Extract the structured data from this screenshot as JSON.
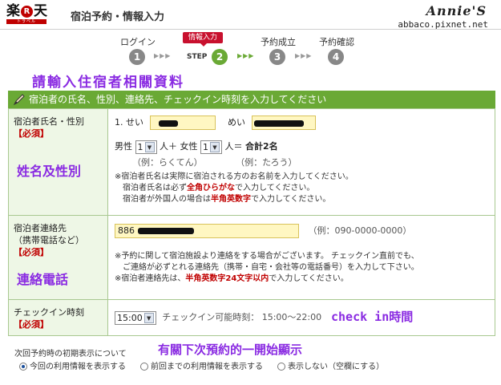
{
  "header": {
    "logo_text_left": "楽",
    "logo_text_r": "R",
    "logo_text_right": "天",
    "logo_subtext": "トラベル",
    "title": "宿泊予約・情報入力",
    "watermark_name": "Annie'S",
    "watermark_url": "abbaco.pixnet.net"
  },
  "steps": [
    {
      "label": "ログイン",
      "number": "1"
    },
    {
      "label": "情報入力",
      "number": "2",
      "step_word": "STEP",
      "active": true
    },
    {
      "label": "予約成立",
      "number": "3"
    },
    {
      "label": "予約確認",
      "number": "4"
    }
  ],
  "step_arrows": "▶▶▶",
  "annotations": {
    "top": "請輸入住宿者相關資料",
    "name_gender": "姓名及性別",
    "phone": "連絡電話",
    "checkin": "check in時間",
    "display": "有關下次預約的一開始顯示"
  },
  "banner": "宿泊者の氏名、性別、連絡先、チェックイン時刻を入力してください",
  "guest_name": {
    "label": "宿泊者氏名・性別",
    "required": "【必須】",
    "sei_label": "1. せい",
    "mei_label": "めい",
    "male_label": "男性",
    "male_value": "1",
    "person_plus": "人＋",
    "female_label": "女性",
    "female_value": "1",
    "person_eq": "人＝",
    "total": "合計2名",
    "example1": "（例：らくてん）",
    "example2": "（例：たろう）",
    "note1": "※宿泊者氏名は実際に宿泊される方のお名前を入力してください。",
    "note2_a": "宿泊者氏名は必ず",
    "note2_red": "全角ひらがな",
    "note2_b": "で入力してください。",
    "note3_a": "宿泊者が外国人の場合は",
    "note3_red": "半角英数字",
    "note3_b": "で入力してください。"
  },
  "contact": {
    "label": "宿泊者連絡先",
    "label2": "（携帯電話など）",
    "required": "【必須】",
    "phone_value": "886",
    "example": "（例：090-0000-0000）",
    "note1": "※予約に関して宿泊施設より連絡をする場合がございます。 チェックイン直前でも、",
    "note2": "ご連絡が必ずとれる連絡先（携帯・自宅・会社等の電話番号）を入力して下さい。",
    "note3_a": "※宿泊者連絡先は、",
    "note3_red": "半角英数字24文字以内",
    "note3_b": "で入力してください。"
  },
  "checkin": {
    "label": "チェックイン時刻",
    "required": "【必須】",
    "time_value": "15:00",
    "possible": "チェックイン可能時刻：  15:00〜22:00"
  },
  "next_display": {
    "question": "次回予約時の初期表示について",
    "options": [
      {
        "label": "今回の利用情報を表示する",
        "selected": true
      },
      {
        "label": "前回までの利用情報を表示する",
        "selected": false
      },
      {
        "label": "表示しない（空欄にする）",
        "selected": false
      }
    ]
  },
  "colors": {
    "accent_green": "#6aa935",
    "required_red": "#c00000",
    "annotation_purple": "#8a2be2"
  }
}
